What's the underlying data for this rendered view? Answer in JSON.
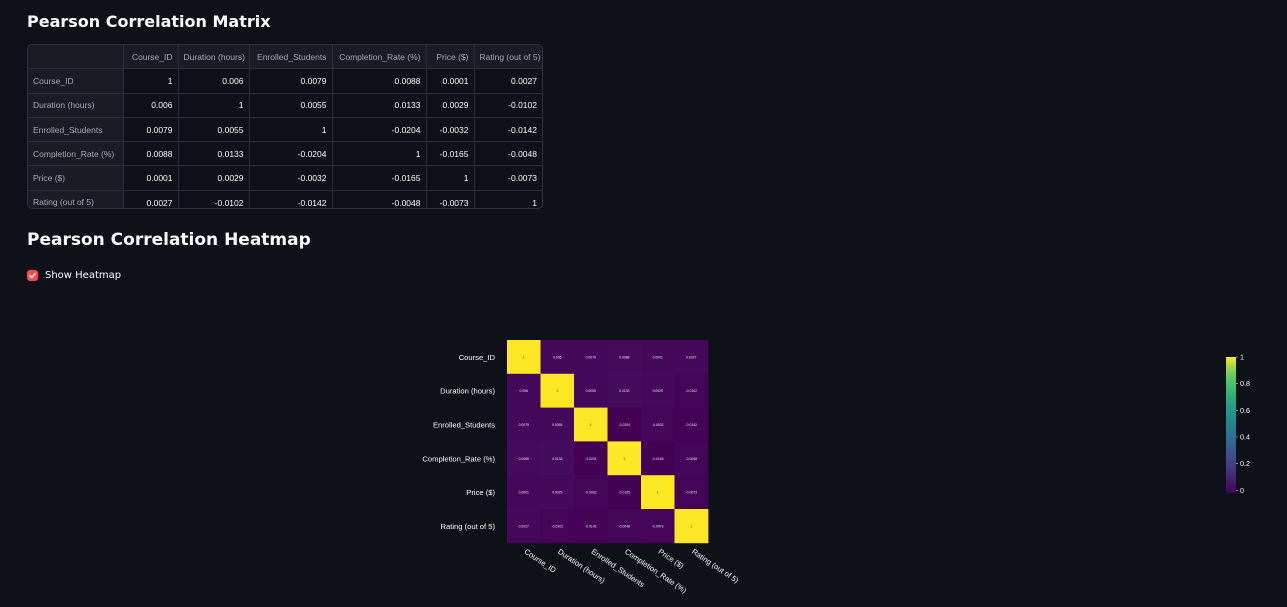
{
  "sections": {
    "matrix_title": "Pearson Correlation Matrix",
    "heatmap_title": "Pearson Correlation Heatmap"
  },
  "table": {
    "columns": [
      "Course_ID",
      "Duration (hours)",
      "Enrolled_Students",
      "Completion_Rate (%)",
      "Price ($)",
      "Rating (out of 5)"
    ],
    "rows": [
      {
        "label": "Course_ID",
        "values": [
          "1",
          "0.006",
          "0.0079",
          "0.0088",
          "0.0001",
          "0.0027"
        ]
      },
      {
        "label": "Duration (hours)",
        "values": [
          "0.006",
          "1",
          "0.0055",
          "0.0133",
          "0.0029",
          "-0.0102"
        ]
      },
      {
        "label": "Enrolled_Students",
        "values": [
          "0.0079",
          "0.0055",
          "1",
          "-0.0204",
          "-0.0032",
          "-0.0142"
        ]
      },
      {
        "label": "Completion_Rate (%)",
        "values": [
          "0.0088",
          "0.0133",
          "-0.0204",
          "1",
          "-0.0165",
          "-0.0048"
        ]
      },
      {
        "label": "Price ($)",
        "values": [
          "0.0001",
          "0.0029",
          "-0.0032",
          "-0.0165",
          "1",
          "-0.0073"
        ]
      },
      {
        "label": "Rating (out of 5)",
        "values": [
          "0.0027",
          "-0.0102",
          "-0.0142",
          "-0.0048",
          "-0.0073",
          "1"
        ]
      }
    ]
  },
  "checkbox": {
    "label": "Show Heatmap",
    "checked": true,
    "color": "#ff4b4b"
  },
  "chart_data": {
    "type": "heatmap",
    "x": [
      "Course_ID",
      "Duration (hours)",
      "Enrolled_Students",
      "Completion_Rate (%)",
      "Price ($)",
      "Rating (out of 5)"
    ],
    "y": [
      "Course_ID",
      "Duration (hours)",
      "Enrolled_Students",
      "Completion_Rate (%)",
      "Price ($)",
      "Rating (out of 5)"
    ],
    "z": [
      [
        1,
        0.006,
        0.0079,
        0.0088,
        0.0001,
        0.0027
      ],
      [
        0.006,
        1,
        0.0055,
        0.0133,
        0.0029,
        -0.0102
      ],
      [
        0.0079,
        0.0055,
        1,
        -0.0204,
        -0.0032,
        -0.0142
      ],
      [
        0.0088,
        0.0133,
        -0.0204,
        1,
        -0.0165,
        -0.0048
      ],
      [
        0.0001,
        0.0029,
        -0.0032,
        -0.0165,
        1,
        -0.0073
      ],
      [
        0.0027,
        -0.0102,
        -0.0142,
        -0.0048,
        -0.0073,
        1
      ]
    ],
    "colorscale": "Viridis",
    "zrange": [
      -0.0204,
      1
    ],
    "colorbar_ticks": [
      "0",
      "0.2",
      "0.4",
      "0.6",
      "0.8",
      "1"
    ],
    "colorbar_tick_values": [
      0,
      0.2,
      0.4,
      0.6,
      0.8,
      1
    ],
    "x_tick_angle": "rotated 45°"
  }
}
